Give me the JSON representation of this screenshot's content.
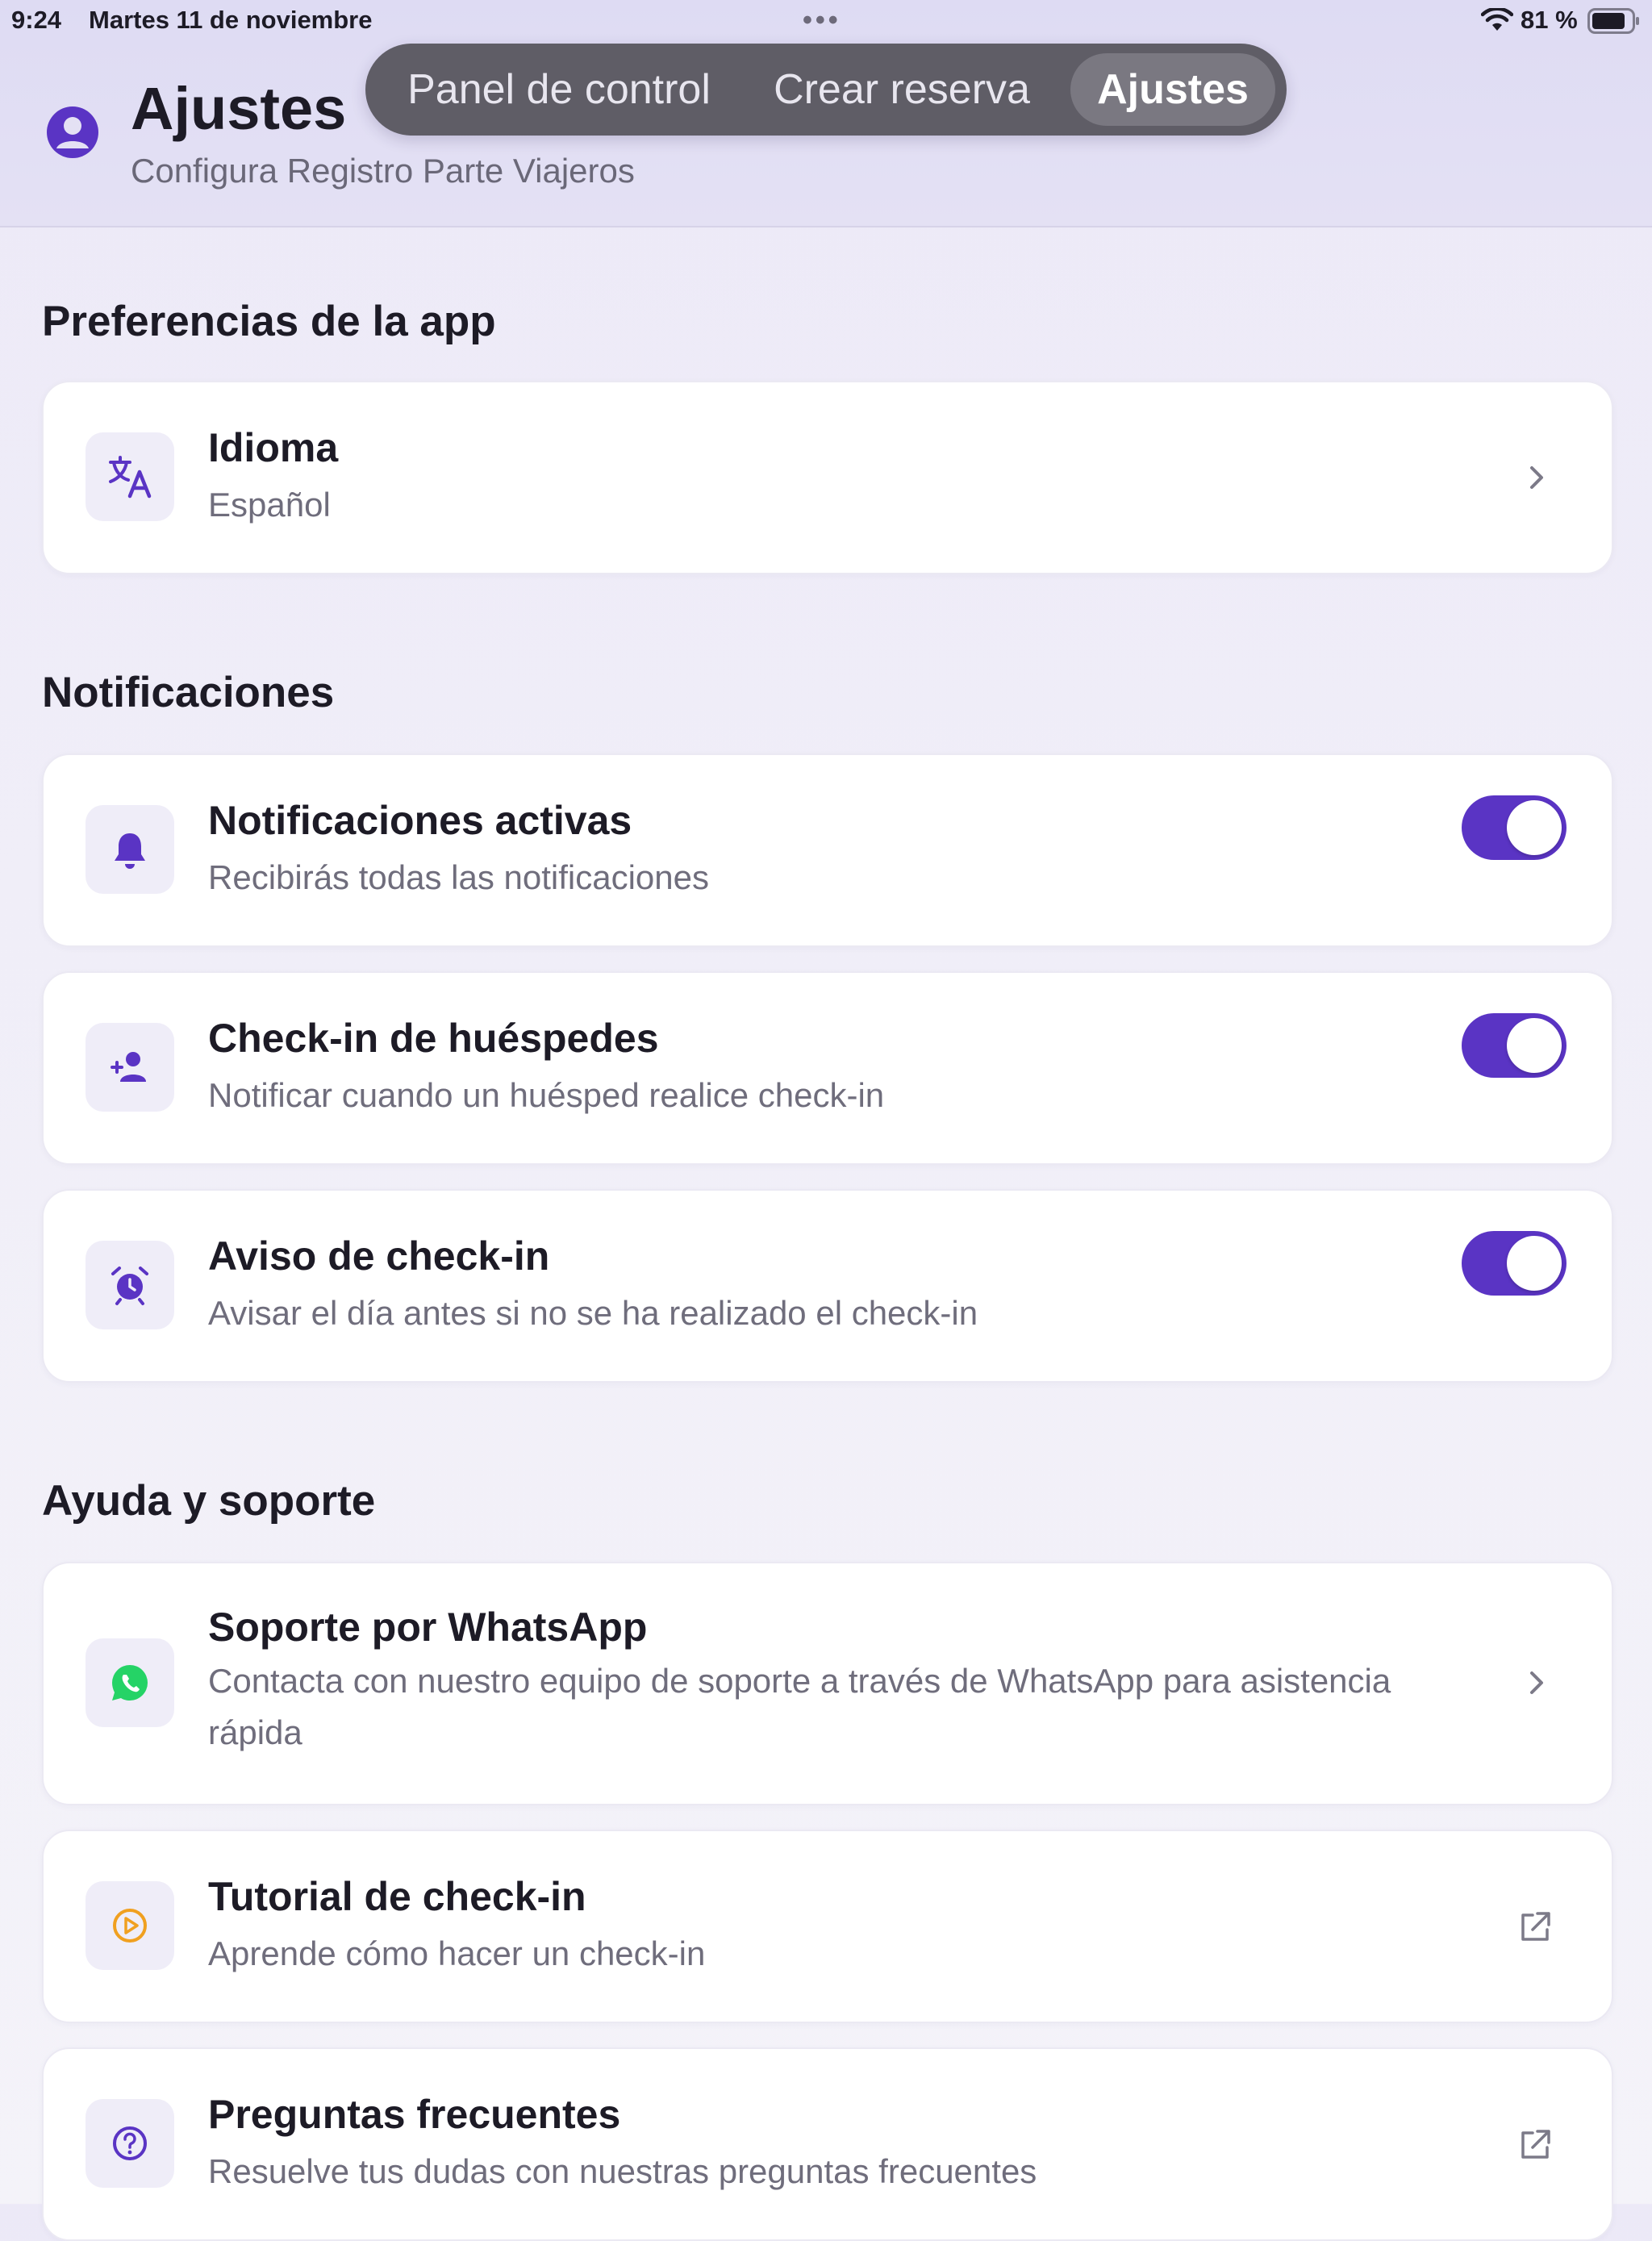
{
  "status_bar": {
    "time": "9:24",
    "date": "Martes 11 de noviembre",
    "more": "•••",
    "battery_percent": "81 %"
  },
  "header": {
    "title": "Ajustes",
    "subtitle": "Configura Registro Parte Viajeros"
  },
  "tabs": [
    {
      "label": "Panel de control",
      "selected": false
    },
    {
      "label": "Crear reserva",
      "selected": false
    },
    {
      "label": "Ajustes",
      "selected": true
    }
  ],
  "sections": {
    "app_prefs": {
      "title": "Preferencias de la app",
      "language": {
        "title": "Idioma",
        "value": "Español",
        "icon": "translate-icon"
      }
    },
    "notifications": {
      "title": "Notificaciones",
      "items": [
        {
          "title": "Notificaciones activas",
          "subtitle": "Recibirás todas las notificaciones",
          "icon": "bell-icon",
          "enabled": true
        },
        {
          "title": "Check-in de huéspedes",
          "subtitle": "Notificar cuando un huésped realice check-in",
          "icon": "person-add-icon",
          "enabled": true
        },
        {
          "title": "Aviso de check-in",
          "subtitle": "Avisar el día antes si no se ha realizado el check-in",
          "icon": "alarm-clock-icon",
          "enabled": true
        }
      ]
    },
    "support": {
      "title": "Ayuda y soporte",
      "items": [
        {
          "title": "Soporte por WhatsApp",
          "subtitle": "Contacta con nuestro equipo de soporte a través de WhatsApp para asistencia rápida",
          "icon": "whatsapp-icon",
          "action": "chevron-right-icon"
        },
        {
          "title": "Tutorial de check-in",
          "subtitle": "Aprende cómo hacer un check-in",
          "icon": "play-circle-icon",
          "action": "external-link-icon"
        },
        {
          "title": "Preguntas frecuentes",
          "subtitle": "Resuelve tus dudas con nuestras preguntas frecuentes",
          "icon": "question-circle-icon",
          "action": "external-link-icon"
        }
      ]
    }
  },
  "colors": {
    "accent": "#5a34c4",
    "whatsapp": "#25d366",
    "tutorial": "#f0a020",
    "header_bg": "#e0ddf3"
  }
}
